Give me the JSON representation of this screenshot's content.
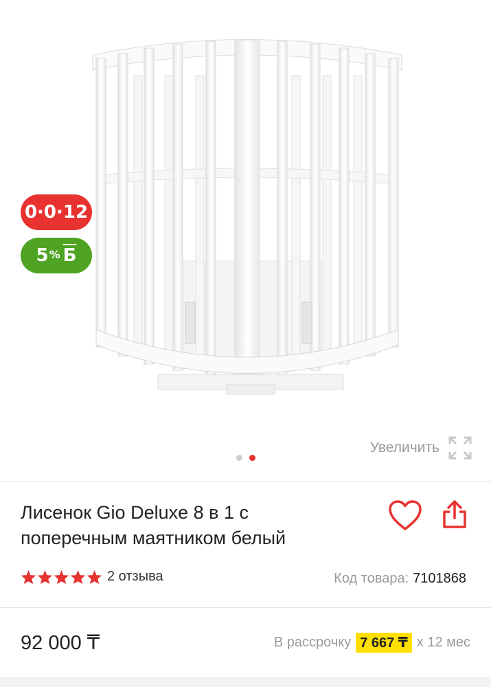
{
  "badges": {
    "installment": "0·0·12",
    "bonus_value": "5",
    "bonus_percent": "%",
    "bonus_currency": "Б"
  },
  "gallery": {
    "zoom_label": "Увеличить",
    "slide_count": 2,
    "active_slide": 2
  },
  "product": {
    "title_line1": "Лисенок Gio Deluxe 8 в 1 с",
    "title_line2": "поперечным маятником белый",
    "rating": 5,
    "reviews": "2 отзыва",
    "sku_label": "Код товара:",
    "sku_value": "7101868"
  },
  "pricing": {
    "price": "92 000 ₸",
    "installment_label": "В рассрочку",
    "monthly": "7 667 ₸",
    "term": "х 12 мес"
  },
  "colors": {
    "accent": "#e7322f",
    "bonus": "#4ea322",
    "highlight": "#ffe000"
  }
}
